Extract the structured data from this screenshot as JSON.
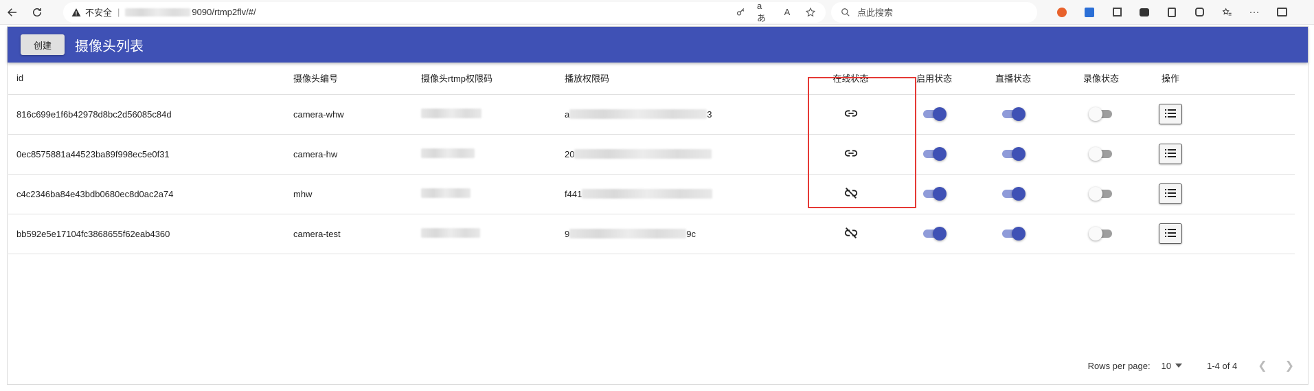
{
  "browser": {
    "insecure_label": "不安全",
    "url_suffix": "9090/rtmp2flv/#/",
    "search_placeholder": "点此搜索",
    "translate_label": "aあ",
    "read_aloud_label": "A",
    "icons": [
      "back-icon",
      "refresh-icon",
      "warning-icon",
      "key-icon",
      "star-icon",
      "search-icon",
      "more-icon"
    ]
  },
  "app": {
    "create_label": "创建",
    "title": "摄像头列表",
    "accent_color": "#3f51b5"
  },
  "table": {
    "columns": [
      "id",
      "摄像头编号",
      "摄像头rtmp权限码",
      "播放权限码",
      "在线状态",
      "启用状态",
      "直播状态",
      "录像状态",
      "操作"
    ],
    "rows": [
      {
        "id": "816c699e1f6b42978d8bc2d56085c84d",
        "code": "camera-whw",
        "play_prefix": "a",
        "play_suffix": "3",
        "online": true,
        "enabled": true,
        "live": true,
        "record": false
      },
      {
        "id": "0ec8575881a44523ba89f998ec5e0f31",
        "code": "camera-hw",
        "play_prefix": "20",
        "play_suffix": "",
        "online": true,
        "enabled": true,
        "live": true,
        "record": false
      },
      {
        "id": "c4c2346ba84e43bdb0680ec8d0ac2a74",
        "code": "mhw",
        "play_prefix": "f441",
        "play_suffix": "",
        "online": false,
        "enabled": true,
        "live": true,
        "record": false
      },
      {
        "id": "bb592e5e17104fc3868655f62eab4360",
        "code": "camera-test",
        "play_prefix": "9",
        "play_suffix": "9c",
        "online": false,
        "enabled": true,
        "live": true,
        "record": false
      }
    ]
  },
  "pagination": {
    "rows_per_page_label": "Rows per page:",
    "rows_per_page_value": "10",
    "range_label": "1-4 of 4"
  }
}
